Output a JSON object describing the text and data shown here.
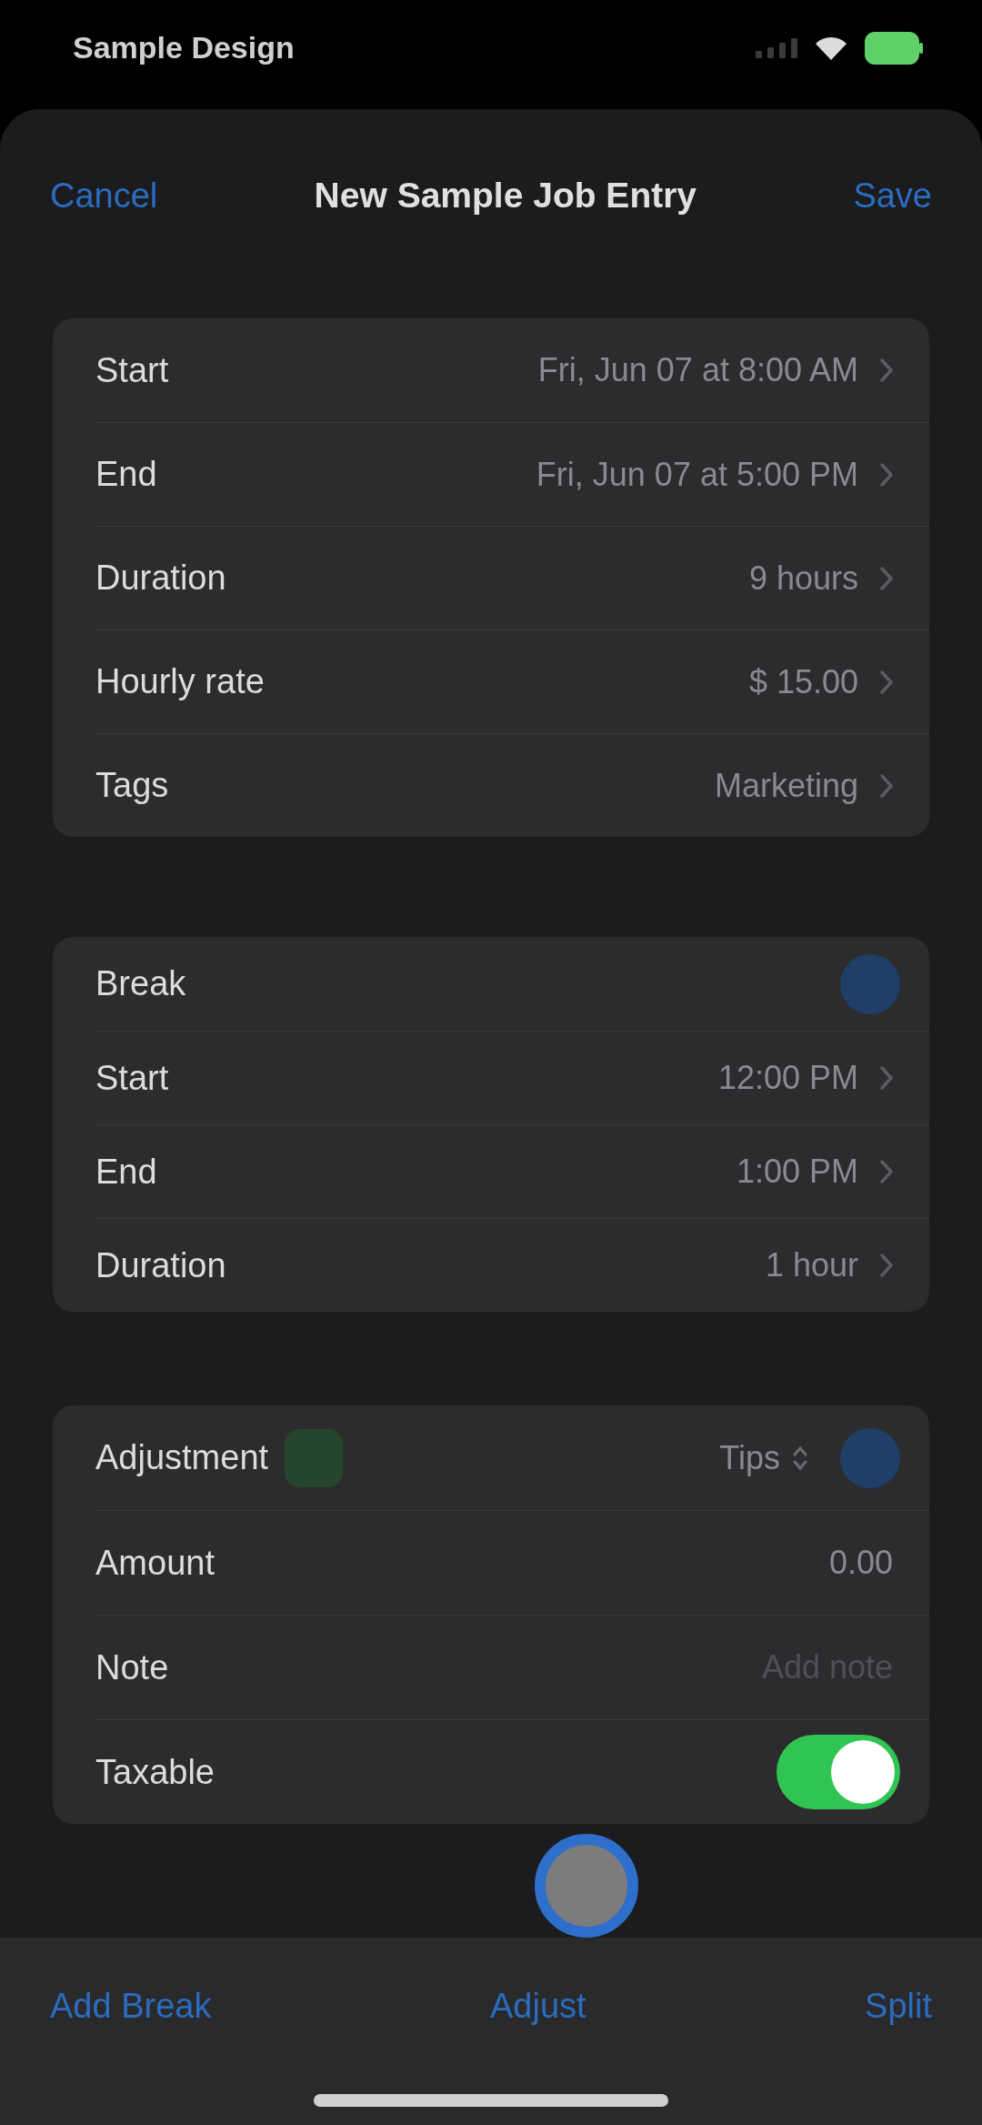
{
  "status_bar": {
    "carrier": "Sample Design"
  },
  "nav": {
    "cancel": "Cancel",
    "title": "New Sample Job Entry",
    "save": "Save"
  },
  "sections": [
    {
      "rows": [
        {
          "kind": "picker",
          "label": "Start",
          "value": "Fri, Jun 07 at 8:00 AM"
        },
        {
          "kind": "picker",
          "label": "End",
          "value": "Fri, Jun 07 at 5:00 PM"
        },
        {
          "kind": "picker",
          "label": "Duration",
          "value": "9 hours"
        },
        {
          "kind": "picker",
          "label": "Hourly rate",
          "value": "$ 15.00"
        },
        {
          "kind": "picker",
          "label": "Tags",
          "value": "Marketing"
        }
      ]
    },
    {
      "rows": [
        {
          "kind": "button",
          "label": "Break"
        },
        {
          "kind": "picker",
          "label": "Start",
          "value": "12:00 PM"
        },
        {
          "kind": "picker",
          "label": "End",
          "value": "1:00 PM"
        },
        {
          "kind": "picker",
          "label": "Duration",
          "value": "1 hour"
        }
      ]
    },
    {
      "rows": [
        {
          "kind": "menu",
          "label": "Adjustment",
          "value": "Tips"
        },
        {
          "kind": "value",
          "label": "Amount",
          "value": "0.00"
        },
        {
          "kind": "field",
          "label": "Note",
          "placeholder": "Add note"
        },
        {
          "kind": "toggle",
          "label": "Taxable",
          "on": true
        }
      ]
    }
  ],
  "toolbar": [
    "Add Break",
    "Adjust",
    "Split"
  ]
}
